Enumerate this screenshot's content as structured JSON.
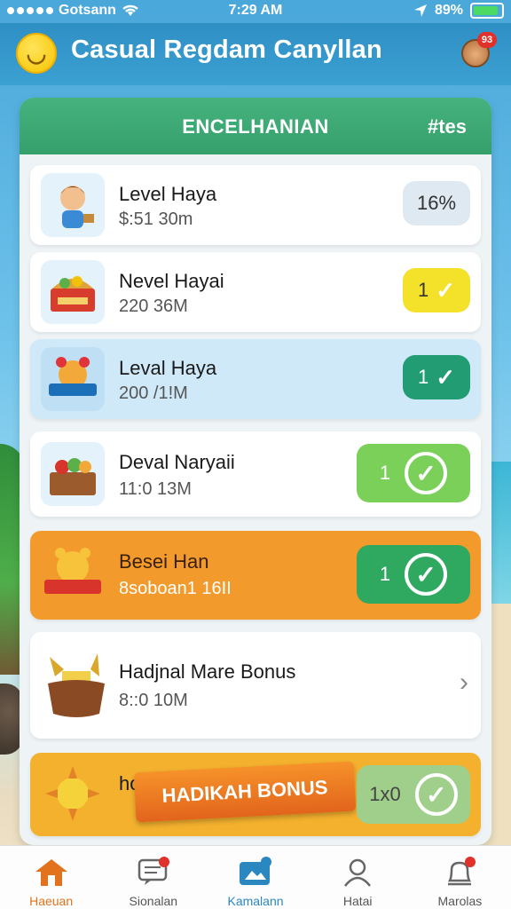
{
  "status_bar": {
    "carrier": "Gotsann",
    "time": "7:29 AM",
    "battery": "89%",
    "battery_level": 0.89
  },
  "app": {
    "title": "Casual Regdam Canyllan",
    "logo_icon": "smile-coin-icon",
    "avatar_badge": "93"
  },
  "panel": {
    "title": "ENCELHANIAN",
    "action": "#tes"
  },
  "rows": [
    {
      "title": "Level Haya",
      "subtitle": "$:51 30m",
      "pill": "16%",
      "icon": "character-icon"
    },
    {
      "title": "Nevel Hayai",
      "subtitle": "220 36M",
      "pill": "1",
      "icon": "treasure-chest-icon"
    },
    {
      "title": "Leval Haya",
      "subtitle": "200 /1!M",
      "pill": "1",
      "icon": "bear-badge-icon"
    },
    {
      "title": "Deval Naryaii",
      "subtitle": "11:0 13M",
      "pill": "1",
      "icon": "fruit-basket-icon"
    },
    {
      "title": "Besei Han",
      "subtitle": "8soboan1 16II",
      "pill": "1",
      "icon": "sun-badge-icon"
    },
    {
      "title": "Hadjnal Mare Bonus",
      "subtitle": "8::0 10M",
      "icon": "gold-pot-icon"
    },
    {
      "title": "ho",
      "banner": "HADIKAH BONUS",
      "pill": "1x0",
      "icon": "star-sun-icon"
    }
  ],
  "colors": {
    "header_green": "#3aa673",
    "highlight_blue": "#cfe9f8",
    "orange": "#f39a2c",
    "yellow": "#f4e22a",
    "teal_green": "#229c72",
    "lime": "#7bd05a"
  },
  "nav": [
    {
      "label": "Haeuan",
      "icon": "home-icon"
    },
    {
      "label": "Sionalan",
      "icon": "chat-icon"
    },
    {
      "label": "Kamalann",
      "icon": "photo-icon"
    },
    {
      "label": "Hatai",
      "icon": "person-icon"
    },
    {
      "label": "Marolas",
      "icon": "bell-icon"
    }
  ]
}
